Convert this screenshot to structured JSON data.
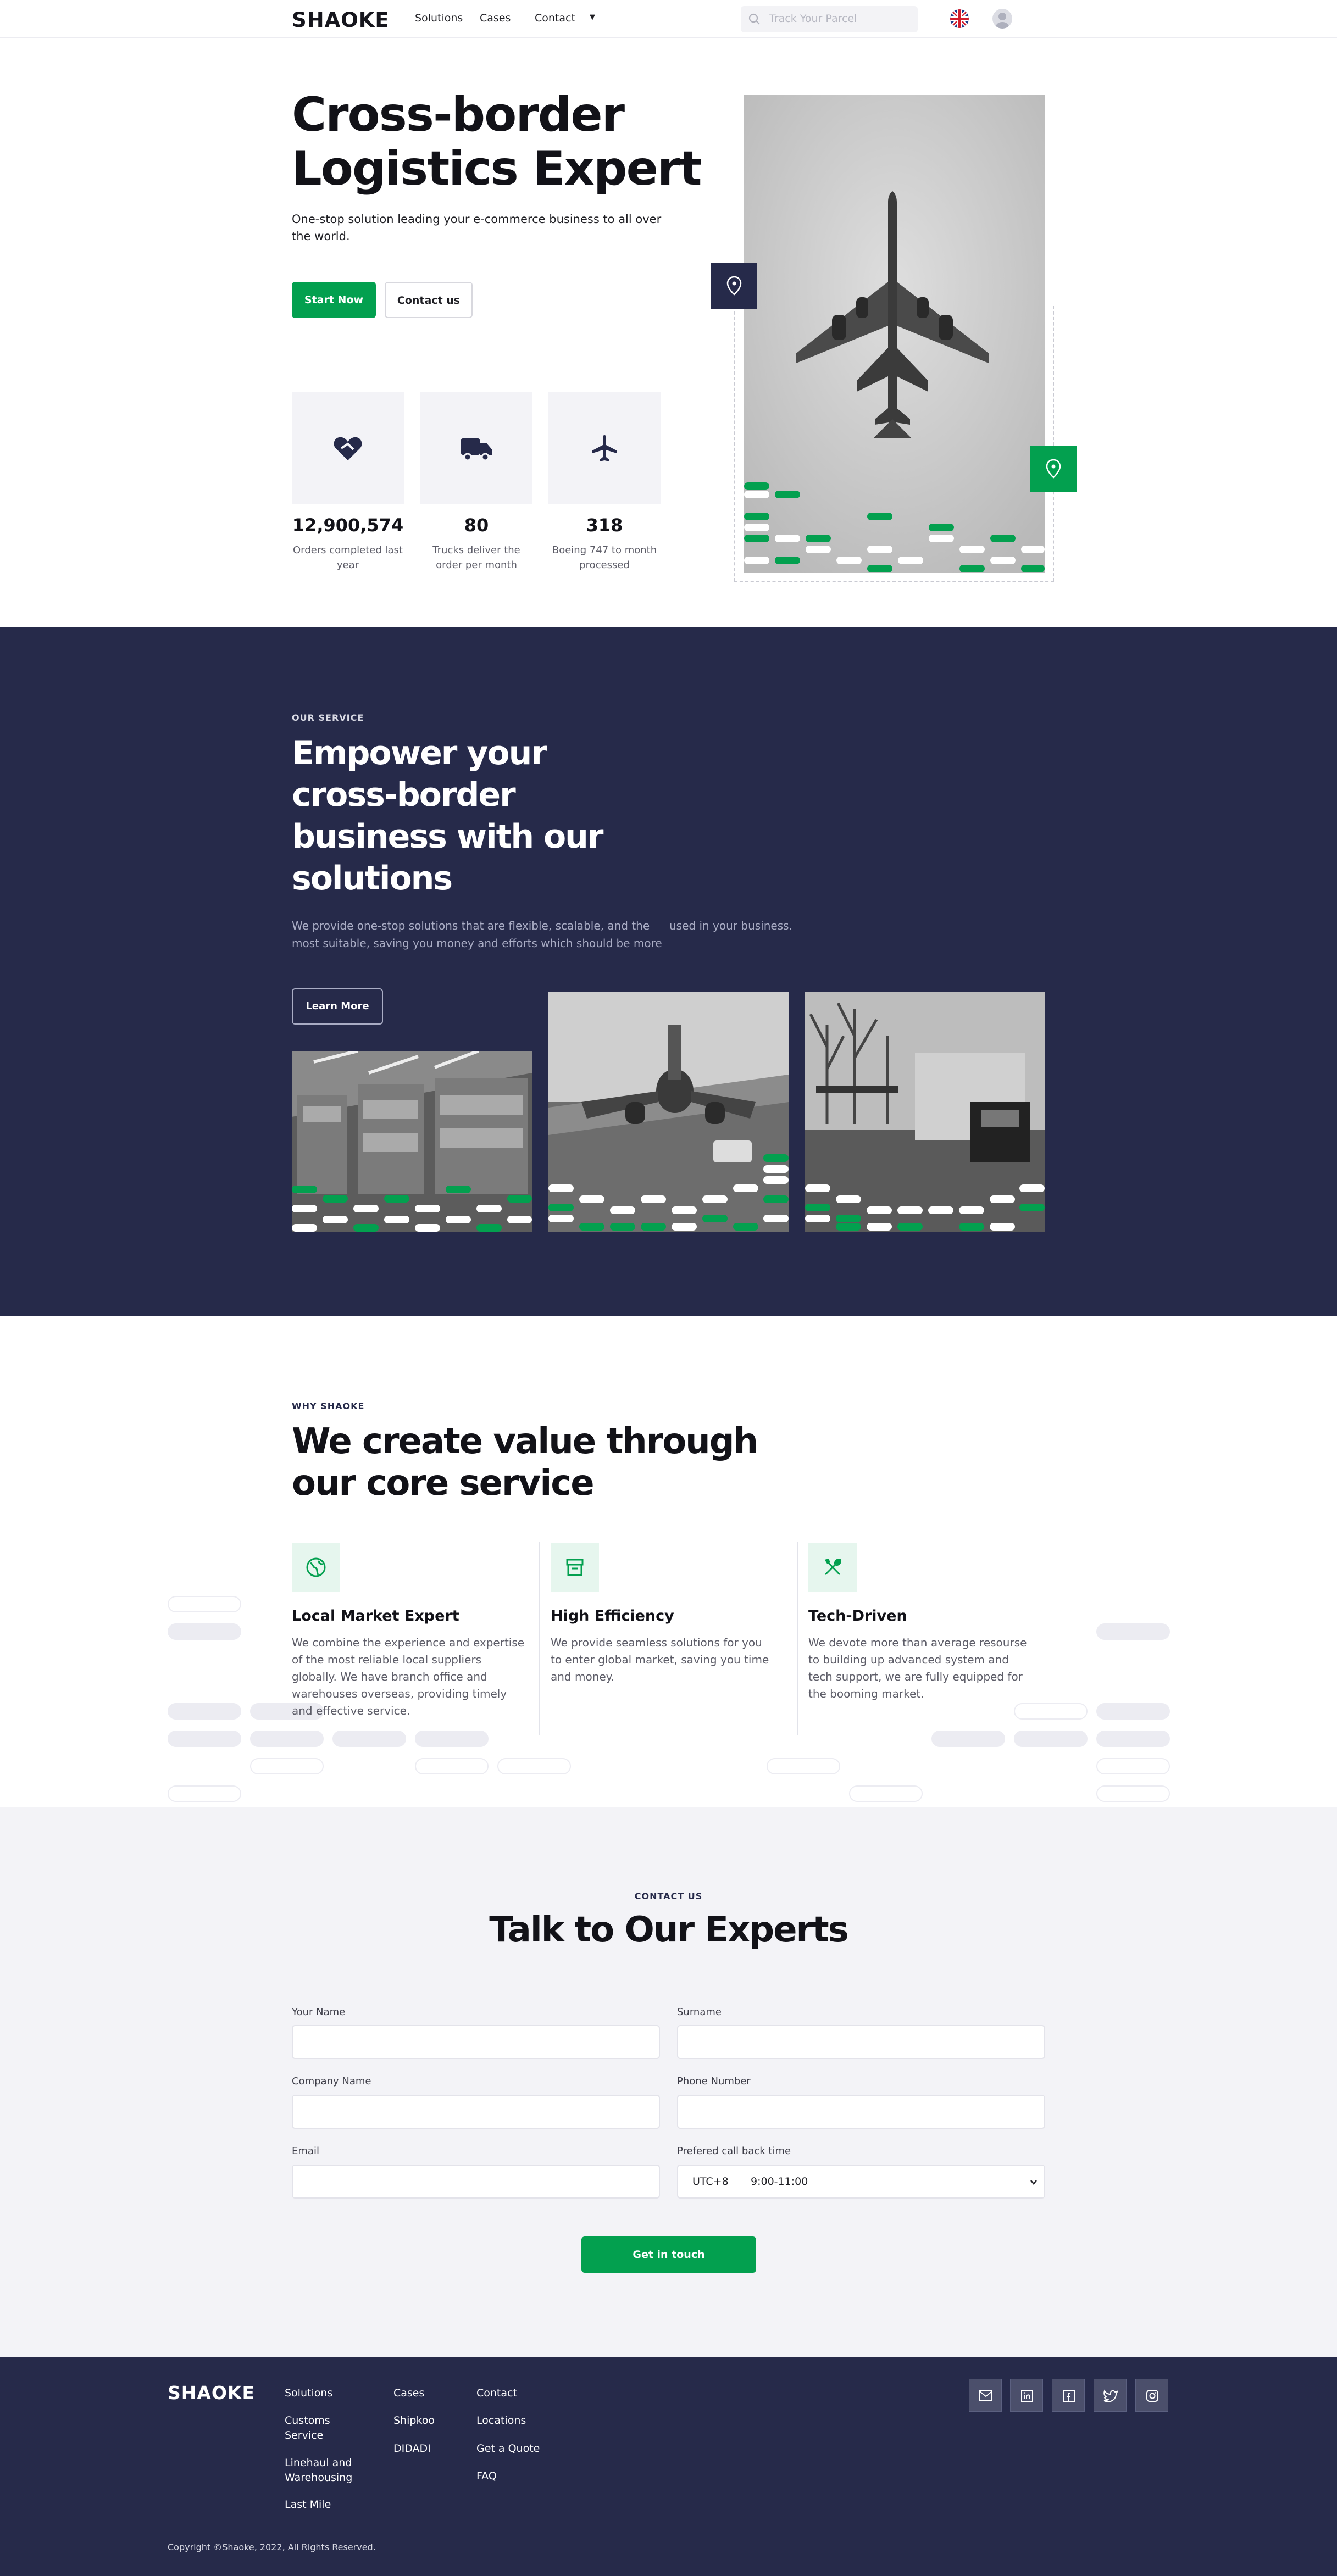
{
  "nav": {
    "logo": "SHAOKE",
    "links": [
      "Solutions",
      "Cases",
      "Contact"
    ],
    "search_placeholder": "Track Your Parcel"
  },
  "hero": {
    "title": "Cross-border Logistics Expert",
    "subtitle": "One-stop solution leading your e-commerce business to all over the world.",
    "start_label": "Start Now",
    "contact_label": "Contact us",
    "stats": [
      {
        "value": "12,900,574",
        "label": "Orders completed last year",
        "icon": "heart-handshake-icon"
      },
      {
        "value": "80",
        "label": "Trucks deliver the order per month",
        "icon": "truck-icon"
      },
      {
        "value": "318",
        "label": "Boeing 747 to month processed",
        "icon": "airplane-icon"
      }
    ]
  },
  "service": {
    "eyebrow": "OUR SERVICE",
    "title": "Empower your cross-border business with our solutions",
    "desc_line1": "We provide one-stop solutions that are flexible, scalable, and the",
    "desc_line1b": "used in your business.",
    "desc_line2": "most suitable, saving you money and efforts which should be more",
    "learn_label": "Learn More"
  },
  "why": {
    "eyebrow": "WHY SHAOKE",
    "title": "We create value through our core service",
    "features": [
      {
        "title": "Local Market Expert",
        "text": "We combine the experience and expertise of the most reliable local suppliers globally. We have branch office and warehouses overseas, providing timely and effective service.",
        "icon": "globe-icon"
      },
      {
        "title": "High Efficiency",
        "text": "We provide seamless solutions for you to enter global market, saving you time and money.",
        "icon": "archive-box-icon"
      },
      {
        "title": "Tech-Driven",
        "text": "We devote more than average resourse to building up advanced system and tech support, we are fully equipped for the booming market.",
        "icon": "tools-icon"
      }
    ]
  },
  "contact": {
    "eyebrow": "CONTACT US",
    "title": "Talk to Our Experts",
    "labels": {
      "name": "Your Name",
      "surname": "Surname",
      "company": "Company Name",
      "phone": "Phone Number",
      "email": "Email",
      "callback": "Prefered call back time"
    },
    "timezone": "UTC+8",
    "time_value": "9:00-11:00",
    "submit_label": "Get in touch"
  },
  "footer": {
    "logo": "SHAOKE",
    "col1": [
      "Solutions",
      "Customs Service",
      "Linehaul and Warehousing",
      "Last Mile"
    ],
    "col2": [
      "Cases",
      "Shipkoo",
      "DIDADI"
    ],
    "col3": [
      "Contact",
      "Locations",
      "Get a Quote",
      "FAQ"
    ],
    "social": [
      "mail-icon",
      "linkedin-icon",
      "facebook-icon",
      "twitter-icon",
      "instagram-icon"
    ],
    "copyright": "Copyright ©Shaoke, 2022, All Rights Reserved."
  },
  "colors": {
    "navy": "#262a4a",
    "green": "#03a04f",
    "light": "#f3f3f7"
  }
}
